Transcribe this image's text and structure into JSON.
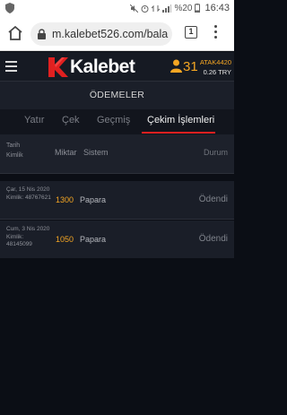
{
  "status_bar": {
    "battery": "%20",
    "time": "16:43"
  },
  "browser": {
    "url": "m.kalebet526.com/bala",
    "tab_count": "1"
  },
  "site": {
    "logo_text": "Kalebet",
    "user_count": "31",
    "account_name": "ATAK4420",
    "account_balance": "0.26 TRY",
    "brand_color": "#e02020",
    "accent_color": "#f5a623"
  },
  "page": {
    "title": "ÖDEMELER"
  },
  "tabs": [
    {
      "label": "Yatır",
      "active": false
    },
    {
      "label": "Çek",
      "active": false
    },
    {
      "label": "Geçmiş",
      "active": false
    },
    {
      "label": "Çekim İşlemleri",
      "active": true
    }
  ],
  "table": {
    "headers": {
      "date": "Tarih",
      "id": "Kimlik",
      "amount": "Miktar",
      "system": "Sistem",
      "status": "Durum"
    },
    "rows": [
      {
        "date": "Çar, 15 Nis 2020",
        "id_label": "Kimlik:",
        "id": "48767621",
        "amount": "1300",
        "system": "Papara",
        "status": "Ödendi"
      },
      {
        "date": "Cum, 3 Nis 2020",
        "id_label": "Kimlik:",
        "id": "48145099",
        "amount": "1050",
        "system": "Papara",
        "status": "Ödendi"
      }
    ]
  }
}
